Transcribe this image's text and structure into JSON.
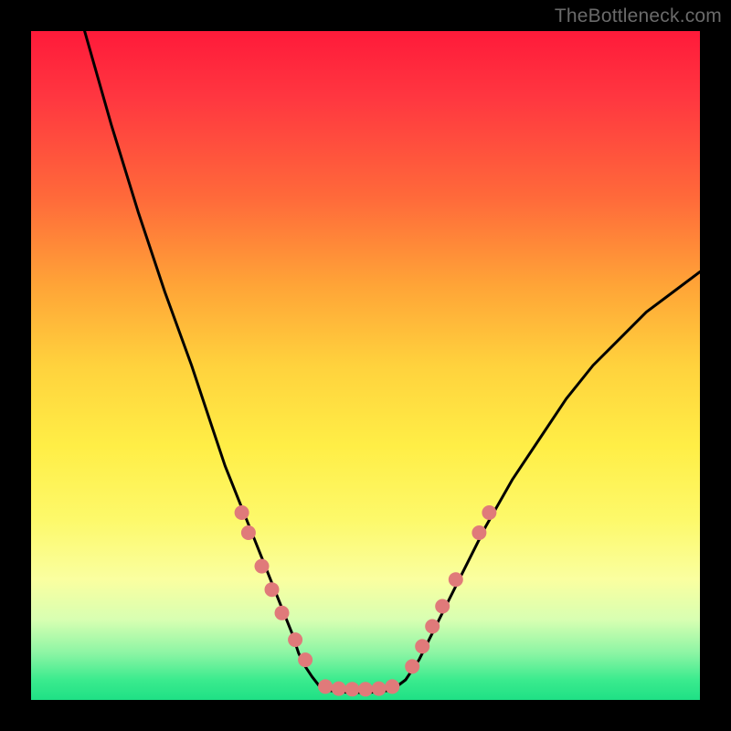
{
  "watermark": "TheBottleneck.com",
  "chart_data": {
    "type": "line",
    "title": "",
    "xlabel": "",
    "ylabel": "",
    "xlim": [
      0,
      100
    ],
    "ylim": [
      0,
      100
    ],
    "series": [
      {
        "name": "left-curve",
        "x": [
          8,
          12,
          16,
          20,
          24,
          27,
          29,
          31,
          33,
          35,
          37,
          39,
          40,
          41,
          42,
          43,
          44
        ],
        "values": [
          100,
          86,
          73,
          61,
          50,
          41,
          35,
          30,
          25,
          20,
          15,
          10,
          7,
          5,
          3.5,
          2.2,
          1.5
        ]
      },
      {
        "name": "flat-bottom",
        "x": [
          44,
          46,
          48,
          50,
          52,
          54
        ],
        "values": [
          1.5,
          1.2,
          1.1,
          1.1,
          1.2,
          1.5
        ]
      },
      {
        "name": "right-curve",
        "x": [
          54,
          56,
          58,
          60,
          62,
          65,
          68,
          72,
          76,
          80,
          84,
          88,
          92,
          96,
          100
        ],
        "values": [
          1.5,
          3,
          6,
          10,
          14,
          20,
          26,
          33,
          39,
          45,
          50,
          54,
          58,
          61,
          64
        ]
      }
    ],
    "markers": {
      "name": "dot-cluster",
      "color": "#e07a7a",
      "radius_px": 8,
      "points": [
        {
          "x": 31.5,
          "y": 28
        },
        {
          "x": 32.5,
          "y": 25
        },
        {
          "x": 34.5,
          "y": 20
        },
        {
          "x": 36.0,
          "y": 16.5
        },
        {
          "x": 37.5,
          "y": 13
        },
        {
          "x": 39.5,
          "y": 9
        },
        {
          "x": 41.0,
          "y": 6
        },
        {
          "x": 44.0,
          "y": 2.0
        },
        {
          "x": 46.0,
          "y": 1.7
        },
        {
          "x": 48.0,
          "y": 1.6
        },
        {
          "x": 50.0,
          "y": 1.6
        },
        {
          "x": 52.0,
          "y": 1.7
        },
        {
          "x": 54.0,
          "y": 2.0
        },
        {
          "x": 57.0,
          "y": 5
        },
        {
          "x": 58.5,
          "y": 8
        },
        {
          "x": 60.0,
          "y": 11
        },
        {
          "x": 61.5,
          "y": 14
        },
        {
          "x": 63.5,
          "y": 18
        },
        {
          "x": 67.0,
          "y": 25
        },
        {
          "x": 68.5,
          "y": 28
        }
      ]
    },
    "background_gradient": {
      "top": "#ff1a3a",
      "mid": "#ffee46",
      "bottom": "#1fe085"
    }
  }
}
